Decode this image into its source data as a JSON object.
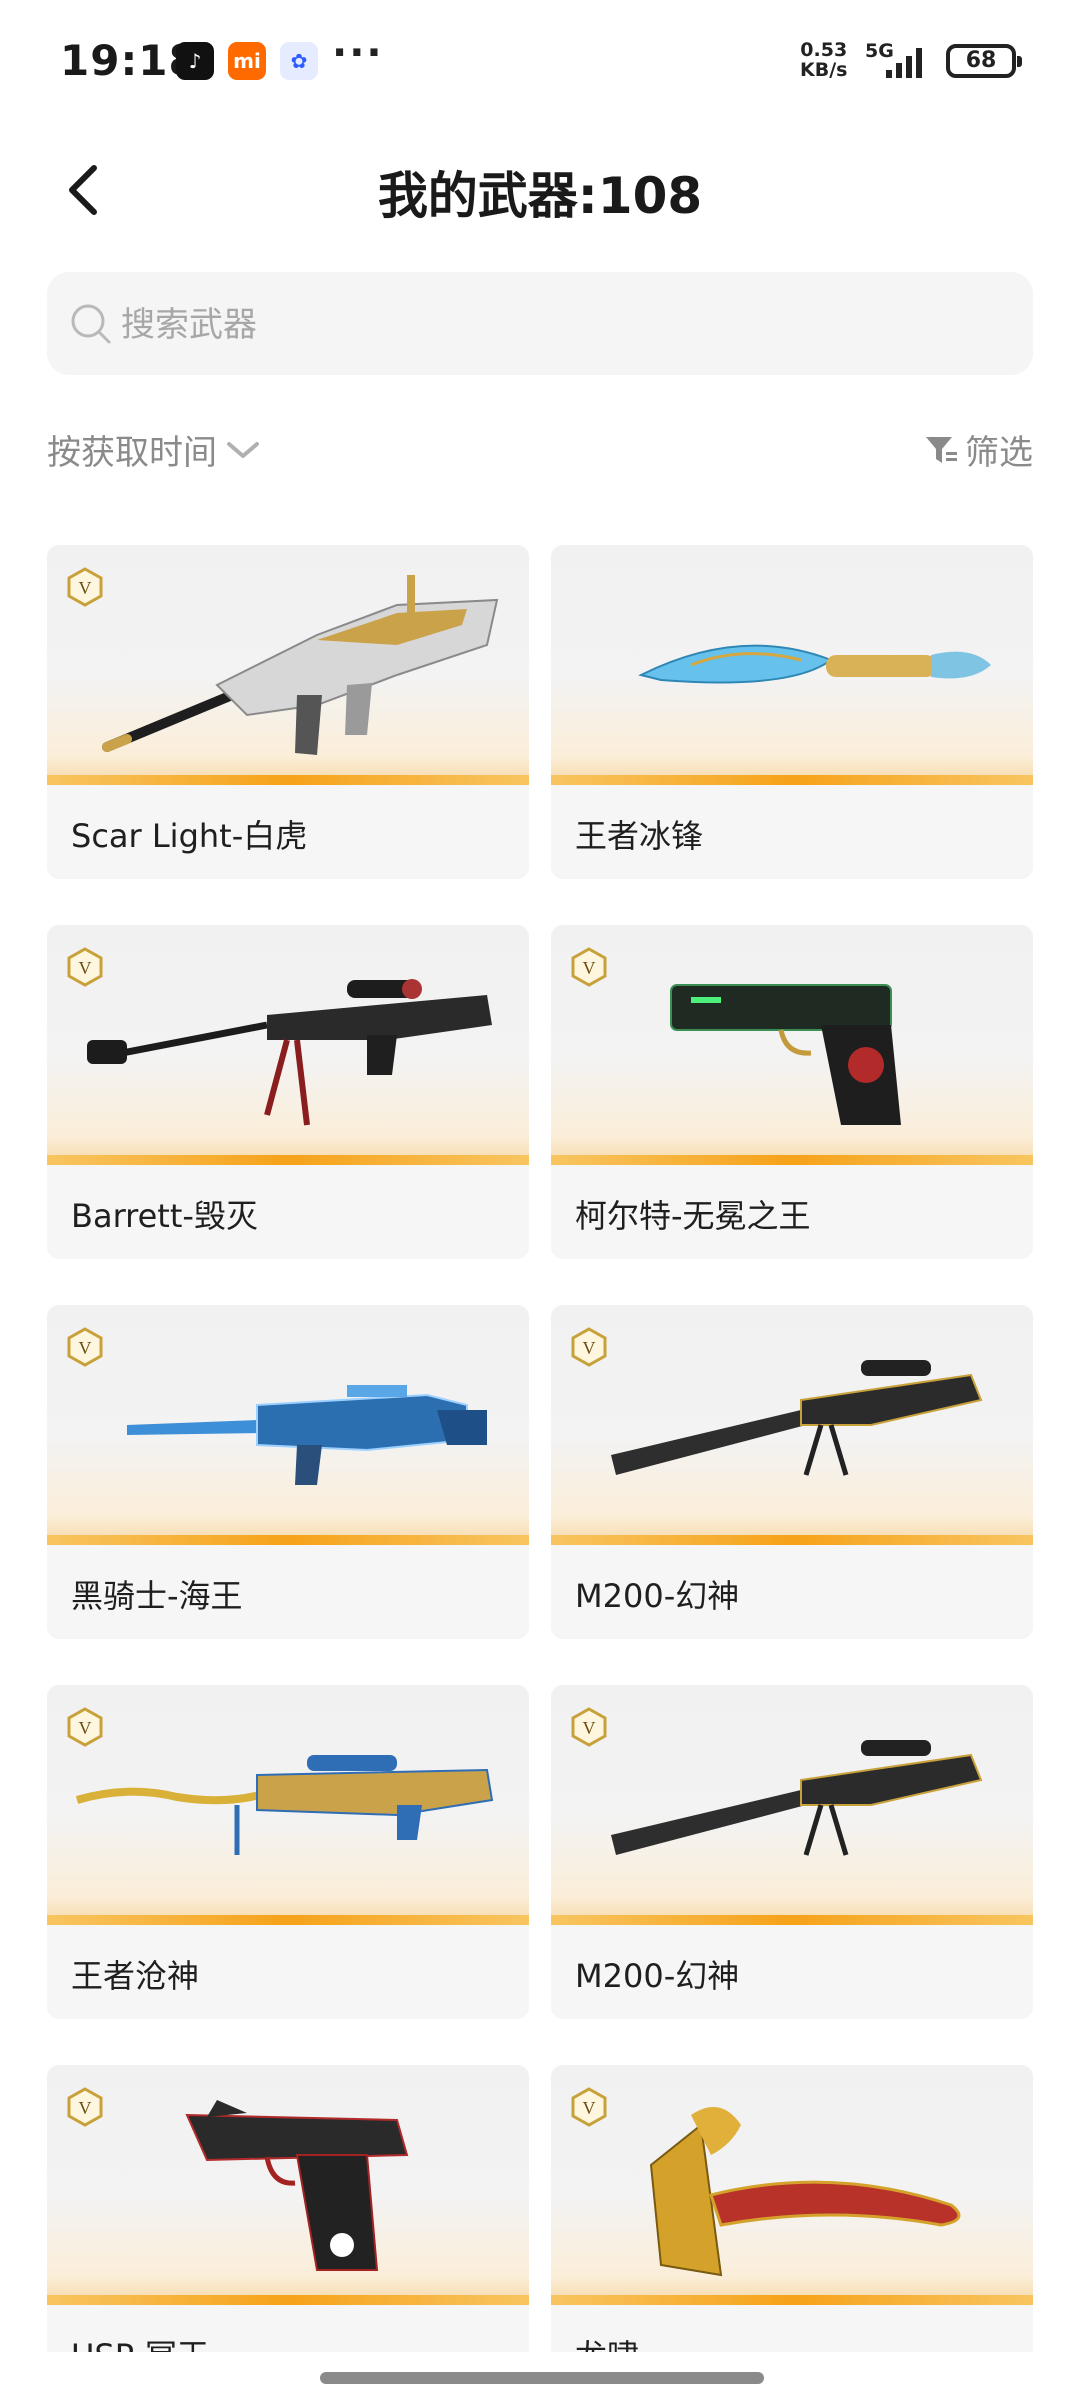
{
  "status_bar": {
    "time": "19:18",
    "apps": [
      "tiktok-icon",
      "mi-icon",
      "baidu-icon"
    ],
    "more": "···",
    "speed_value": "0.53",
    "speed_unit": "KB/s",
    "network": "5G",
    "battery": "68"
  },
  "header": {
    "back_icon": "chevron-left-icon",
    "title": "我的武器:108"
  },
  "search": {
    "placeholder": "搜索武器",
    "icon": "search-icon"
  },
  "toolbar": {
    "sort_label": "按获取时间",
    "filter_label": "筛选"
  },
  "colors": {
    "accent_orange": "#f6a21a",
    "badge_gold": "#c9a13b",
    "card_bg": "#f6f6f6",
    "muted_text": "#8a8a8a"
  },
  "weapons": [
    {
      "name": "Scar Light-白虎",
      "vip": true
    },
    {
      "name": "王者冰锋",
      "vip": false
    },
    {
      "name": "Barrett-毁灭",
      "vip": true
    },
    {
      "name": "柯尔特-无冕之王",
      "vip": true
    },
    {
      "name": "黑骑士-海王",
      "vip": true
    },
    {
      "name": "M200-幻神",
      "vip": true
    },
    {
      "name": "王者沧神",
      "vip": true
    },
    {
      "name": "M200-幻神",
      "vip": true
    },
    {
      "name": "USP-冥王",
      "vip": true
    },
    {
      "name": "龙啸",
      "vip": true
    }
  ],
  "vip_badge_letter": "V"
}
